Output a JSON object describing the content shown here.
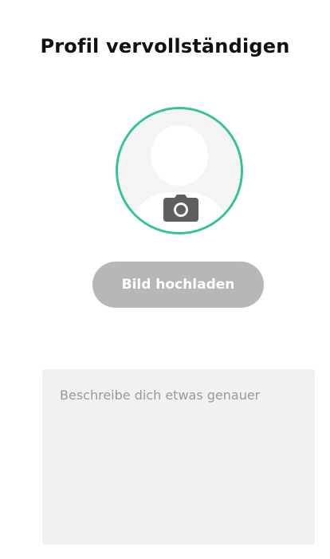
{
  "header": {
    "title": "Profil vervollständigen"
  },
  "avatar": {
    "ring_color": "#35c58a",
    "placeholder_icon": "user-silhouette-icon",
    "camera_icon": "camera-icon"
  },
  "upload": {
    "label": "Bild hochladen",
    "background": "#b7b7b7"
  },
  "description": {
    "value": "",
    "placeholder": "Beschreibe dich etwas genauer"
  }
}
